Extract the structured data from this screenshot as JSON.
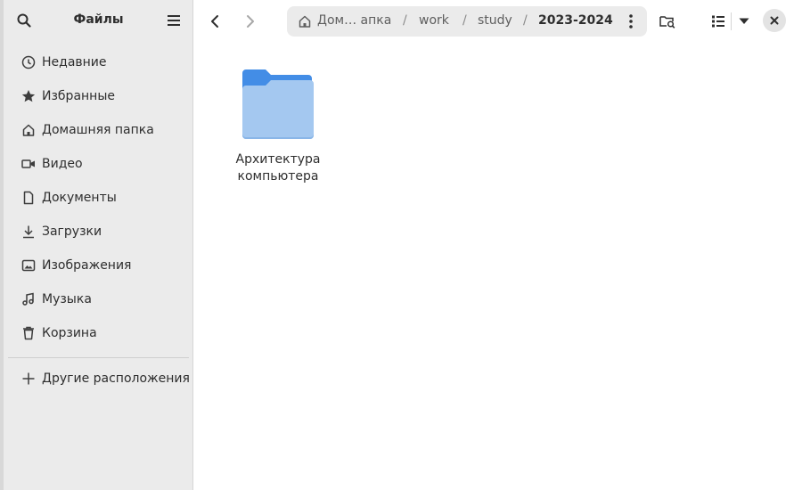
{
  "sidebar": {
    "title": "Файлы",
    "items": [
      {
        "label": "Недавние",
        "icon": "clock-icon"
      },
      {
        "label": "Избранные",
        "icon": "star-icon"
      },
      {
        "label": "Домашняя папка",
        "icon": "home-icon"
      },
      {
        "label": "Видео",
        "icon": "video-icon"
      },
      {
        "label": "Документы",
        "icon": "document-icon"
      },
      {
        "label": "Загрузки",
        "icon": "download-icon"
      },
      {
        "label": "Изображения",
        "icon": "image-icon"
      },
      {
        "label": "Музыка",
        "icon": "music-icon"
      },
      {
        "label": "Корзина",
        "icon": "trash-icon"
      }
    ],
    "other_locations": {
      "label": "Другие расположения",
      "icon": "plus-icon"
    }
  },
  "toolbar": {
    "path": [
      {
        "label": "Дом… апка",
        "icon": "home-icon"
      },
      {
        "label": "work"
      },
      {
        "label": "study"
      },
      {
        "label": "2023-2024"
      }
    ],
    "separator": "/"
  },
  "content": {
    "items": [
      {
        "name": "Архитектура компьютера",
        "type": "folder",
        "icon": "folder-icon"
      }
    ]
  },
  "colors": {
    "folder_front": "#a4c8f0",
    "folder_back": "#438de6",
    "sidebar_bg": "#ebebeb"
  }
}
